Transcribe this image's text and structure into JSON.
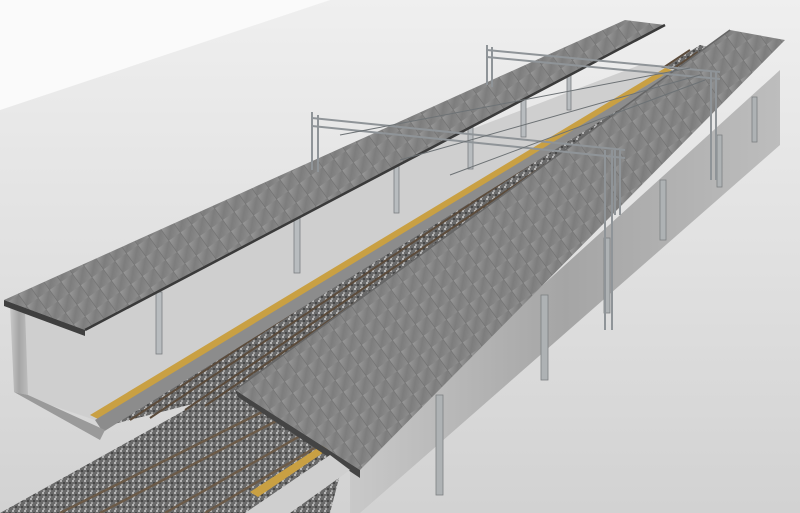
{
  "scene": {
    "subject": "3d-railway-station-model",
    "colors": {
      "sky": "#f4f4f4",
      "ground": "#d9d9d9",
      "roof": "#8a8a8a",
      "roof_dark": "#4a4a4a",
      "platform_edge": "#c8a040",
      "ballast": "#6b6b6b",
      "rail": "#5a4a3a",
      "steel": "#a9acae"
    }
  }
}
